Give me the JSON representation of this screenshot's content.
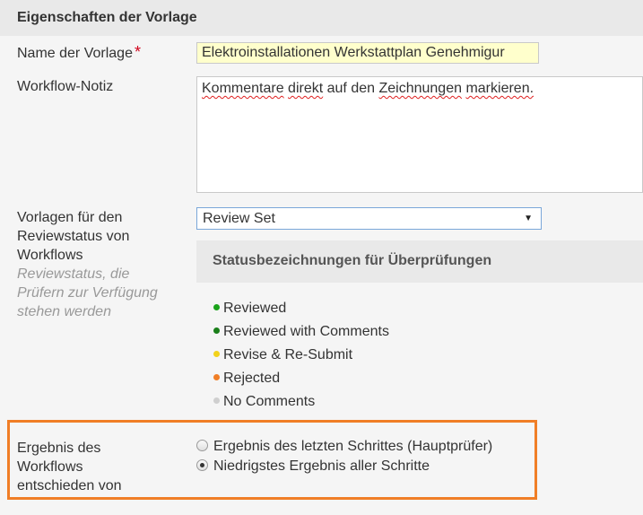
{
  "section": {
    "title": "Eigenschaften der Vorlage"
  },
  "template_name": {
    "label": "Name der Vorlage",
    "required_mark": "*",
    "value": "Elektroinstallationen Werkstattplan Genehmigur"
  },
  "workflow_note": {
    "label": "Workflow-Notiz",
    "words": [
      "Kommentare",
      "direkt",
      "auf",
      "den",
      "Zeichnungen",
      "markieren."
    ]
  },
  "review_status": {
    "label_lines": [
      "Vorlagen für den",
      "Reviewstatus von",
      "Workflows"
    ],
    "hint_lines": [
      "Reviewstatus, die",
      "Prüfern zur Verfügung",
      "stehen werden"
    ],
    "selected": "Review Set",
    "panel_title": "Statusbezeichnungen für Überprüfungen",
    "statuses": [
      {
        "label": "Reviewed",
        "color": "#1aa31a"
      },
      {
        "label": "Reviewed with Comments",
        "color": "#1a7f1a"
      },
      {
        "label": "Revise & Re-Submit",
        "color": "#f2d21b"
      },
      {
        "label": "Rejected",
        "color": "#f07e26"
      },
      {
        "label": "No Comments",
        "color": "#cfcfcf"
      }
    ]
  },
  "workflow_result": {
    "label_lines": [
      "Ergebnis des",
      "Workflows",
      "entschieden von"
    ],
    "options": [
      {
        "label": "Ergebnis des letzten Schrittes (Hauptprüfer)",
        "checked": false
      },
      {
        "label": "Niedrigstes Ergebnis aller Schritte",
        "checked": true
      }
    ],
    "highlight_color": "#f07e26"
  }
}
